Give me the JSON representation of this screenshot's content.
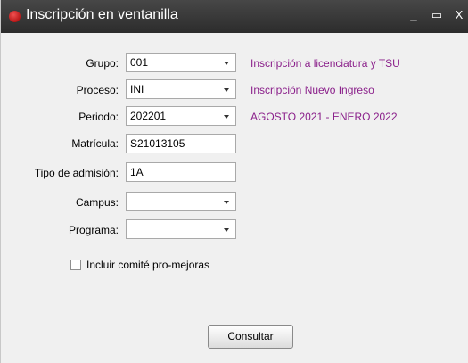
{
  "window": {
    "title": "Inscripción en ventanilla",
    "minimize_glyph": "_",
    "maximize_glyph": "▭",
    "close_glyph": "X"
  },
  "form": {
    "grupo": {
      "label": "Grupo:",
      "value": "001",
      "description": "Inscripción a licenciatura y TSU"
    },
    "proceso": {
      "label": "Proceso:",
      "value": "INI",
      "description": "Inscripción Nuevo Ingreso"
    },
    "periodo": {
      "label": "Periodo:",
      "value": "202201",
      "description": "AGOSTO 2021 - ENERO 2022"
    },
    "matricula": {
      "label": "Matrícula:",
      "value": "S21013105"
    },
    "tipo_admision": {
      "label": "Tipo de admisión:",
      "value": "1A"
    },
    "campus": {
      "label": "Campus:",
      "value": ""
    },
    "programa": {
      "label": "Programa:",
      "value": ""
    },
    "comite_checkbox": {
      "label": "Incluir comité pro-mejoras",
      "checked": false
    },
    "submit_label": "Consultar"
  },
  "colors": {
    "titlebar": "#333333",
    "description_text": "#8a1f8a",
    "app_icon": "#cc1f1f"
  },
  "icons": {
    "app": "app-logo-icon",
    "dropdown": "chevron-down-icon"
  }
}
